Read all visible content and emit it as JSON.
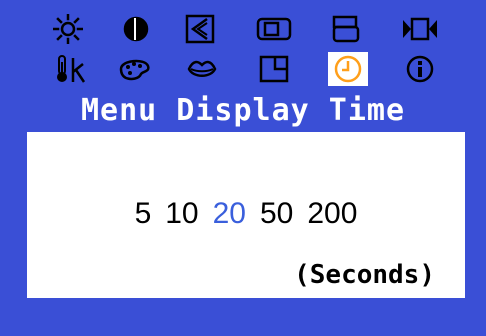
{
  "icons_row1": [
    {
      "name": "brightness-icon",
      "selected": false
    },
    {
      "name": "contrast-icon",
      "selected": false
    },
    {
      "name": "image-size-icon",
      "selected": false
    },
    {
      "name": "position-icon",
      "selected": false
    },
    {
      "name": "coarse-icon",
      "selected": false
    },
    {
      "name": "fine-icon",
      "selected": false
    }
  ],
  "icons_row2": [
    {
      "name": "color-temperature-icon",
      "selected": false
    },
    {
      "name": "color-palette-icon",
      "selected": false
    },
    {
      "name": "lips-icon",
      "selected": false
    },
    {
      "name": "menu-position-icon",
      "selected": false
    },
    {
      "name": "clock-icon",
      "selected": true
    },
    {
      "name": "information-icon",
      "selected": false
    }
  ],
  "menu": {
    "title": "Menu Display Time",
    "options": [
      "5",
      "10",
      "20",
      "50",
      "200"
    ],
    "selected_option": "20",
    "unit_label": "(Seconds)"
  },
  "colors": {
    "background": "#3a4fd6",
    "panel": "#ffffff",
    "highlight_text": "#3a5fdc",
    "selected_icon": "#ff9f1a"
  }
}
